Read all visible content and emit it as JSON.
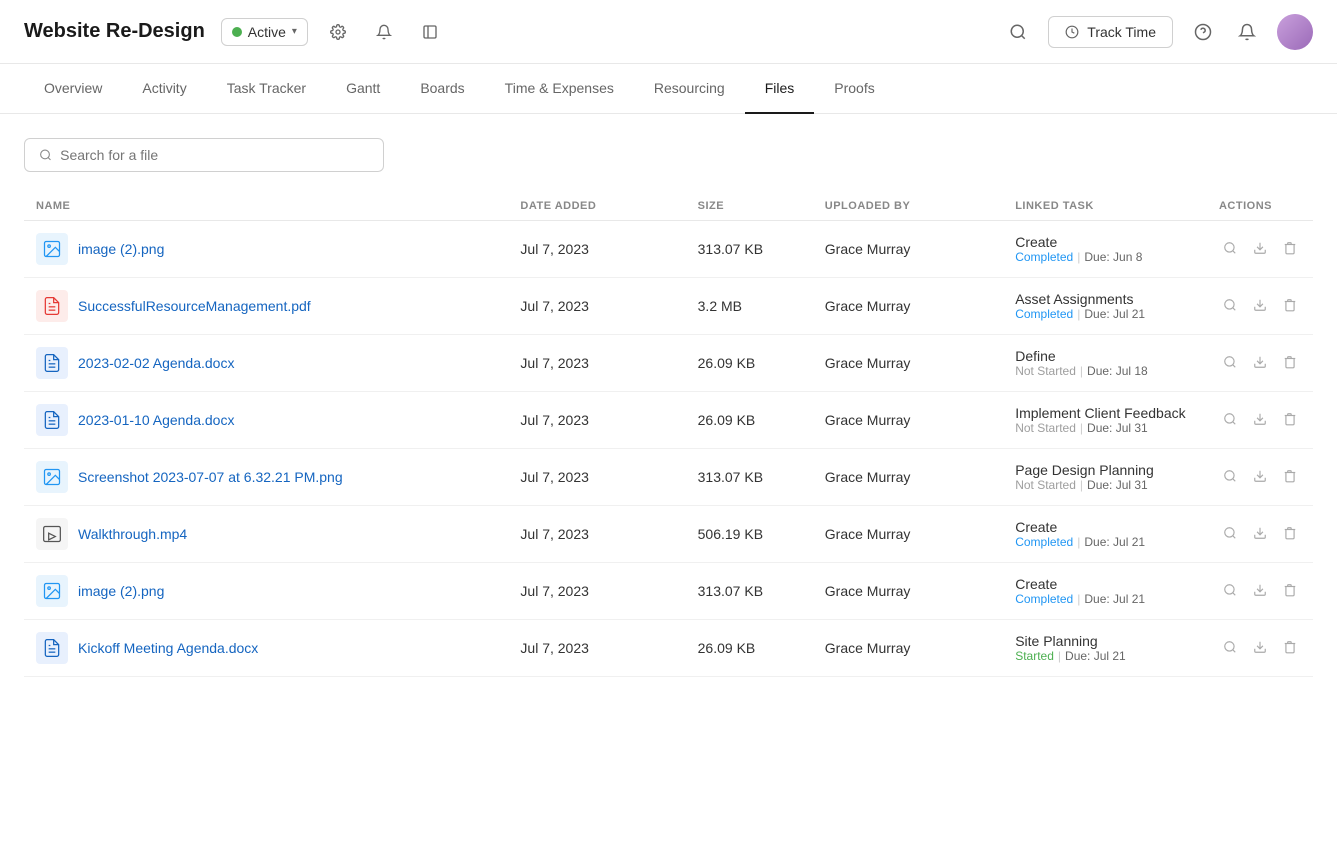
{
  "header": {
    "project_title": "Website Re-Design",
    "status_label": "Active",
    "status_color": "#4caf50",
    "icons": {
      "gear": "⚙",
      "bell": "🔔",
      "sidebar": "▣",
      "search": "🔍",
      "help": "?",
      "notifications": "🔔"
    },
    "track_time_label": "Track Time"
  },
  "nav": {
    "tabs": [
      {
        "label": "Overview",
        "active": false
      },
      {
        "label": "Activity",
        "active": false
      },
      {
        "label": "Task Tracker",
        "active": false
      },
      {
        "label": "Gantt",
        "active": false
      },
      {
        "label": "Boards",
        "active": false
      },
      {
        "label": "Time & Expenses",
        "active": false
      },
      {
        "label": "Resourcing",
        "active": false
      },
      {
        "label": "Files",
        "active": true
      },
      {
        "label": "Proofs",
        "active": false
      }
    ]
  },
  "search": {
    "placeholder": "Search for a file"
  },
  "table": {
    "columns": [
      "NAME",
      "DATE ADDED",
      "SIZE",
      "UPLOADED BY",
      "LINKED TASK",
      "ACTIONS"
    ],
    "rows": [
      {
        "name": "image (2).png",
        "type": "png",
        "date": "Jul 7, 2023",
        "size": "313.07 KB",
        "uploaded_by": "Grace Murray",
        "task_name": "Create",
        "task_status": "Completed",
        "task_due": "Due: Jun 8"
      },
      {
        "name": "SuccessfulResourceManagement.pdf",
        "type": "pdf",
        "date": "Jul 7, 2023",
        "size": "3.2 MB",
        "uploaded_by": "Grace Murray",
        "task_name": "Asset Assignments",
        "task_status": "Completed",
        "task_due": "Due: Jul 21"
      },
      {
        "name": "2023-02-02 Agenda.docx",
        "type": "docx",
        "date": "Jul 7, 2023",
        "size": "26.09 KB",
        "uploaded_by": "Grace Murray",
        "task_name": "Define",
        "task_status": "Not Started",
        "task_due": "Due: Jul 18"
      },
      {
        "name": "2023-01-10 Agenda.docx",
        "type": "docx",
        "date": "Jul 7, 2023",
        "size": "26.09 KB",
        "uploaded_by": "Grace Murray",
        "task_name": "Implement Client Feedback",
        "task_status": "Not Started",
        "task_due": "Due: Jul 31"
      },
      {
        "name": "Screenshot 2023-07-07 at 6.32.21 PM.png",
        "type": "png",
        "date": "Jul 7, 2023",
        "size": "313.07 KB",
        "uploaded_by": "Grace Murray",
        "task_name": "Page Design Planning",
        "task_status": "Not Started",
        "task_due": "Due: Jul 31"
      },
      {
        "name": "Walkthrough.mp4",
        "type": "mp4",
        "date": "Jul 7, 2023",
        "size": "506.19 KB",
        "uploaded_by": "Grace Murray",
        "task_name": "Create",
        "task_status": "Completed",
        "task_due": "Due: Jul 21"
      },
      {
        "name": "image (2).png",
        "type": "png",
        "date": "Jul 7, 2023",
        "size": "313.07 KB",
        "uploaded_by": "Grace Murray",
        "task_name": "Create",
        "task_status": "Completed",
        "task_due": "Due: Jul 21"
      },
      {
        "name": "Kickoff Meeting Agenda.docx",
        "type": "docx",
        "date": "Jul 7, 2023",
        "size": "26.09 KB",
        "uploaded_by": "Grace Murray",
        "task_name": "Site Planning",
        "task_status": "Started",
        "task_due": "Due: Jul 21"
      }
    ]
  }
}
